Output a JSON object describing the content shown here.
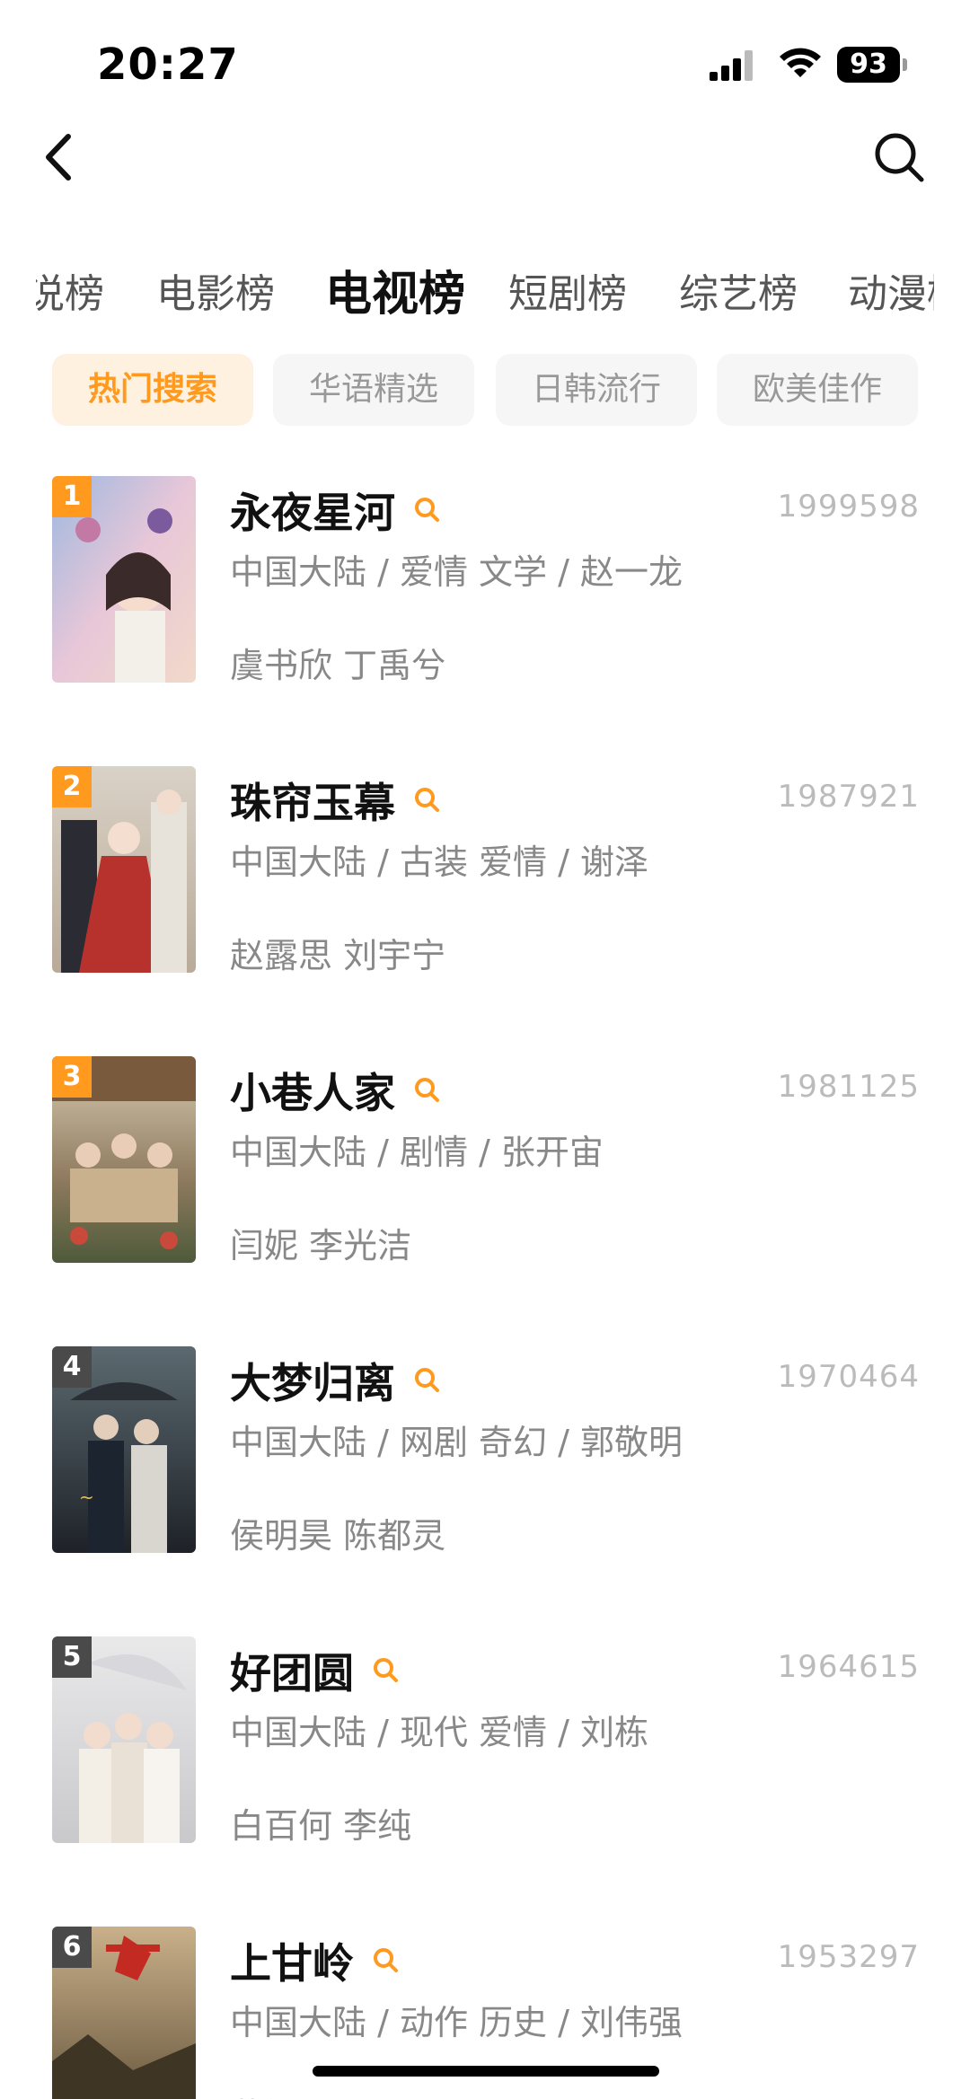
{
  "status_bar": {
    "time": "20:27",
    "battery": "93"
  },
  "nav": {
    "back_icon": "chevron-left-icon",
    "search_icon": "search-icon"
  },
  "tabs": [
    {
      "label": "说榜",
      "active": false
    },
    {
      "label": "电影榜",
      "active": false
    },
    {
      "label": "电视榜",
      "active": true
    },
    {
      "label": "短剧榜",
      "active": false
    },
    {
      "label": "综艺榜",
      "active": false
    },
    {
      "label": "动漫榜",
      "active": false
    }
  ],
  "chips": [
    {
      "label": "热门搜索",
      "active": true
    },
    {
      "label": "华语精选",
      "active": false
    },
    {
      "label": "日韩流行",
      "active": false
    },
    {
      "label": "欧美佳作",
      "active": false
    }
  ],
  "colors": {
    "accent": "#ff9a1f",
    "accent_bg": "#fff1e0",
    "rank_other": "#4a4a4a"
  },
  "items": [
    {
      "rank": "1",
      "title": "永夜星河",
      "score": "1999598",
      "meta": "中国大陆 / 爱情 文学 / 赵一龙",
      "cast": "虞书欣 丁禹兮"
    },
    {
      "rank": "2",
      "title": "珠帘玉幕",
      "score": "1987921",
      "meta": "中国大陆 / 古装 爱情 / 谢泽",
      "cast": "赵露思 刘宇宁"
    },
    {
      "rank": "3",
      "title": "小巷人家",
      "score": "1981125",
      "meta": "中国大陆 / 剧情 / 张开宙",
      "cast": "闫妮 李光洁"
    },
    {
      "rank": "4",
      "title": "大梦归离",
      "score": "1970464",
      "meta": "中国大陆 / 网剧 奇幻 / 郭敬明",
      "cast": "侯明昊 陈都灵"
    },
    {
      "rank": "5",
      "title": "好团圆",
      "score": "1964615",
      "meta": "中国大陆 / 现代 爱情 / 刘栋",
      "cast": "白百何 李纯"
    },
    {
      "rank": "6",
      "title": "上甘岭",
      "score": "1953297",
      "meta": "中国大陆 / 动作 历史 / 刘伟强",
      "cast": "黄轩 王雷"
    }
  ]
}
